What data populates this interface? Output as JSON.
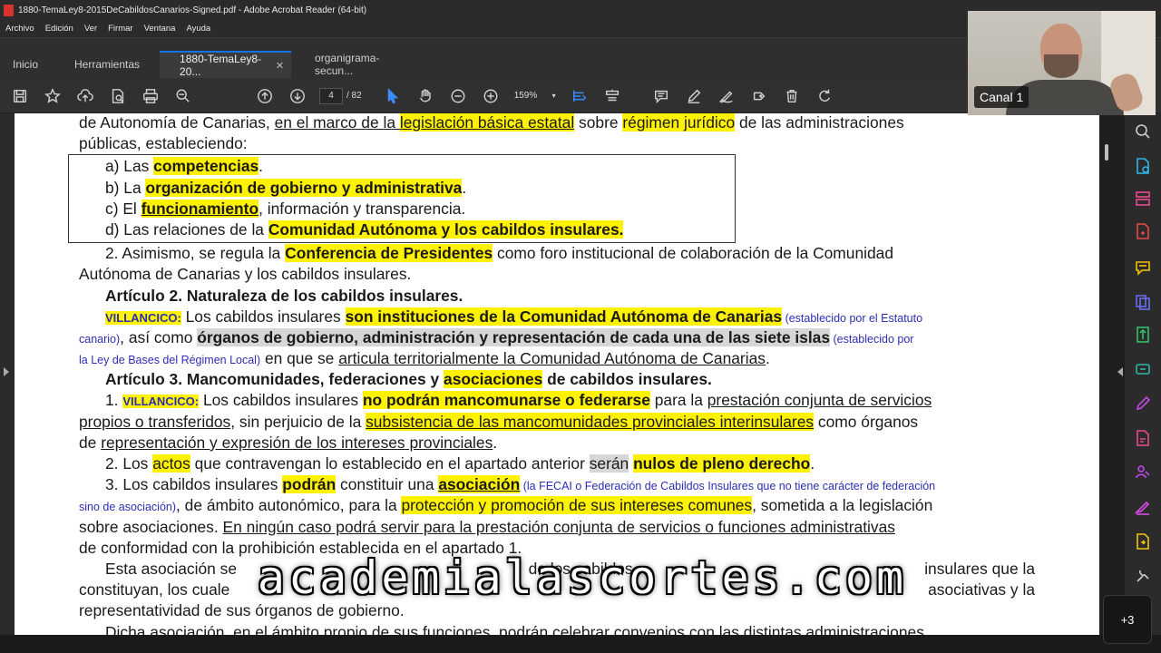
{
  "window": {
    "title": "1880-TemaLey8-2015DeCabildosCanarios-Signed.pdf - Adobe Acrobat Reader (64-bit)"
  },
  "menu": [
    "Archivo",
    "Edición",
    "Ver",
    "Firmar",
    "Ventana",
    "Ayuda"
  ],
  "tabs": {
    "home": "Inicio",
    "tools": "Herramientas",
    "doc1": "1880-TemaLey8-20...",
    "doc2": "organigrama-secun..."
  },
  "toolbar": {
    "page_current": "4",
    "page_total": "/ 82",
    "zoom": "159%"
  },
  "document": {
    "l1": {
      "a": "de Autonomía de Canarias, ",
      "b": "en el marco de la ",
      "c": "legislación básica estatal",
      "d": " sobre ",
      "e": "régimen jurídico",
      "f": " de las administraciones"
    },
    "l2": "públicas, estableciendo:",
    "l3": {
      "a": "a) Las ",
      "b": "competencias",
      "c": "."
    },
    "l4": {
      "a": "b) La ",
      "b": "organización de gobierno y administrativa",
      "c": "."
    },
    "l5": {
      "a": "c) El ",
      "b": "funcionamiento",
      "c": ", información y transparencia."
    },
    "l6": {
      "a": "d) Las relaciones de la ",
      "b": "Comunidad Autónoma y los cabildos insulares."
    },
    "l7": {
      "a": "2. Asimismo, se regula la ",
      "b": "Conferencia de Presidentes",
      "c": " como foro institucional de colaboración de la Comunidad"
    },
    "l8": "Autónoma de Canarias y los cabildos insulares.",
    "l9": "Artículo 2. Naturaleza de los cabildos insulares.",
    "l10": {
      "tag": "VILLANCICO:",
      "a": " Los cabildos insulares ",
      "b": "son instituciones de la Comunidad Autónoma de Canarias",
      "note": " (establecido por el Estatuto"
    },
    "l11": {
      "note": "canario)",
      "a": ", así como ",
      "b": "órganos de gobierno, administración y representación de cada una de las siete islas",
      "note2": " (establecido por"
    },
    "l12": {
      "note": "la Ley de Bases del Régimen Local)",
      "a": " en que se ",
      "b": "articula territorialmente la Comunidad Autónoma de Canarias",
      "c": "."
    },
    "l13": {
      "a": "Artículo 3. Mancomunidades, federaciones y ",
      "b": "asociaciones",
      "c": " de cabildos insulares."
    },
    "l14": {
      "a": "1. ",
      "tag": "VILLANCICO:",
      "b": " Los cabildos insulares ",
      "c": "no podrán mancomunarse o federarse",
      "d": " para la ",
      "e": "prestación conjunta de servicios"
    },
    "l15": {
      "a": "propios o transferidos",
      "b": ", sin perjuicio de la ",
      "c": "subsistencia de las mancomunidades provinciales interinsulares",
      "d": " como órganos"
    },
    "l16": {
      "a": "de ",
      "b": "representación y expresión de los intereses provinciales",
      "c": "."
    },
    "l17": {
      "a": "2. Los ",
      "b": "actos",
      "c": " que contravengan lo establecido en el apartado anterior ",
      "d": "serán",
      "e": " ",
      "f": "nulos de pleno derecho",
      "g": "."
    },
    "l18": {
      "a": "3. Los cabildos insulares ",
      "b": "podrán",
      "c": " constituir una ",
      "d": "asociación",
      "note": " (la FECAI o Federación de Cabildos Insulares que no tiene carácter de federación"
    },
    "l19": {
      "note": "sino de asociación)",
      "a": ", de ámbito autonómico, para la ",
      "b": "protección y promoción de sus intereses comunes",
      "c": ", sometida a la legislación"
    },
    "l20": {
      "a": "sobre asociaciones. ",
      "b": "En ningún caso podrá servir para la prestación conjunta de servicios o funciones administrativas"
    },
    "l21": "de conformidad con la prohibición establecida en el apartado 1.",
    "l22": {
      "a": "Esta asociación se",
      "b": "de los cabildos",
      "c": "insulares que la"
    },
    "l23": {
      "a": "constituyan, los cuale",
      "b": "asociativas y la"
    },
    "l24": "representatividad de sus órganos de gobierno.",
    "l25": "Dicha asociación, en el ámbito propio de sus funciones, podrán celebrar convenios con las distintas administraciones"
  },
  "webcam": {
    "label": "Canal 1"
  },
  "watermark": "academialascortes.com",
  "more_participants": "+3",
  "colors": {
    "highlight": "#fff200",
    "accent": "#1473e6",
    "note_blue": "#2d2db5"
  },
  "icons": [
    "save-icon",
    "star-icon",
    "cloud-upload-icon",
    "file-search-icon",
    "print-icon",
    "zoom-search-icon",
    "arrow-up-icon",
    "arrow-down-icon",
    "cursor-icon",
    "hand-icon",
    "zoom-out-icon",
    "zoom-in-icon",
    "fit-page-icon",
    "scroll-mode-icon",
    "comment-icon",
    "pen-icon",
    "sign-icon",
    "stamp-icon",
    "delete-icon",
    "rotate-icon"
  ]
}
